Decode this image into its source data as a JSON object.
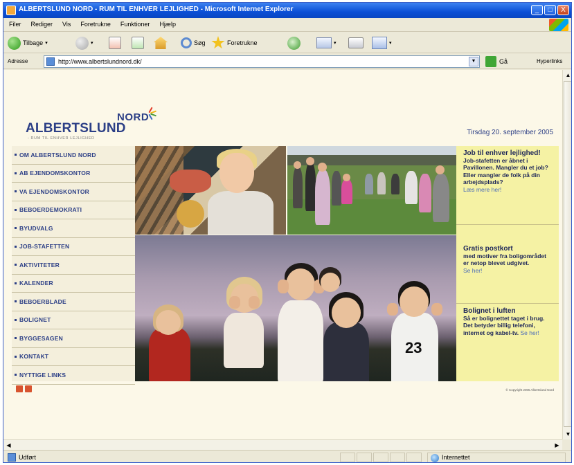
{
  "window": {
    "title": "ALBERTSLUND NORD - RUM TIL ENHVER LEJLIGHED - Microsoft Internet Explorer",
    "controls": [
      "_",
      "□",
      "X"
    ]
  },
  "menu": [
    "Filer",
    "Rediger",
    "Vis",
    "Foretrukne",
    "Funktioner",
    "Hjælp"
  ],
  "toolbar": {
    "back_label": "Tilbage",
    "search_label": "Søg",
    "favorites_label": "Foretrukne"
  },
  "address": {
    "label": "Adresse",
    "url": "http://www.albertslundnord.dk/",
    "go_label": "Gå",
    "links_label": "Hyperlinks"
  },
  "site": {
    "logo_top": "NORD",
    "logo_main": "ALBERTSLUND",
    "tagline": "- RUM TIL ENHVER LEJLIGHED",
    "date": "Tirsdag 20. september 2005",
    "nav": [
      "OM ALBERTSLUND NORD",
      "AB EJENDOMSKONTOR",
      "VA EJENDOMSKONTOR",
      "BEBOERDEMOKRATI",
      "BYUDVALG",
      "JOB-STAFETTEN",
      "AKTIVITETER",
      "KALENDER",
      "BEBOERBLADE",
      "BOLIGNET",
      "BYGGESAGEN",
      "KONTAKT",
      "NYTTIGE LINKS"
    ],
    "news": [
      {
        "title": "Job til enhver lejlighed!",
        "body": "Job-stafetten er åbnet i Pavillonen. Mangler du et job? Eller mangler de folk på din arbejdsplads?",
        "link": "Læs mere her!"
      },
      {
        "title": "Gratis postkort",
        "body": "med motiver fra boligområdet er netop blevet udgivet.",
        "link": "Se her!"
      },
      {
        "title": "Bolignet i luften",
        "body": "Så er bolignettet taget i brug. Det betyder billig telefoni, internet og kabel-tv.",
        "link": "Se her!"
      }
    ],
    "jersey_number": "23",
    "copyright": "© Copyright 2005 Albertslund Nord"
  },
  "status": {
    "text": "Udført",
    "zone": "Internettet"
  },
  "colors": {
    "brand_navy": "#2c3f86",
    "nav_bg": "#f4efdc",
    "news_bg": "#f5f2a4",
    "page_bg": "#fcf8e8"
  }
}
